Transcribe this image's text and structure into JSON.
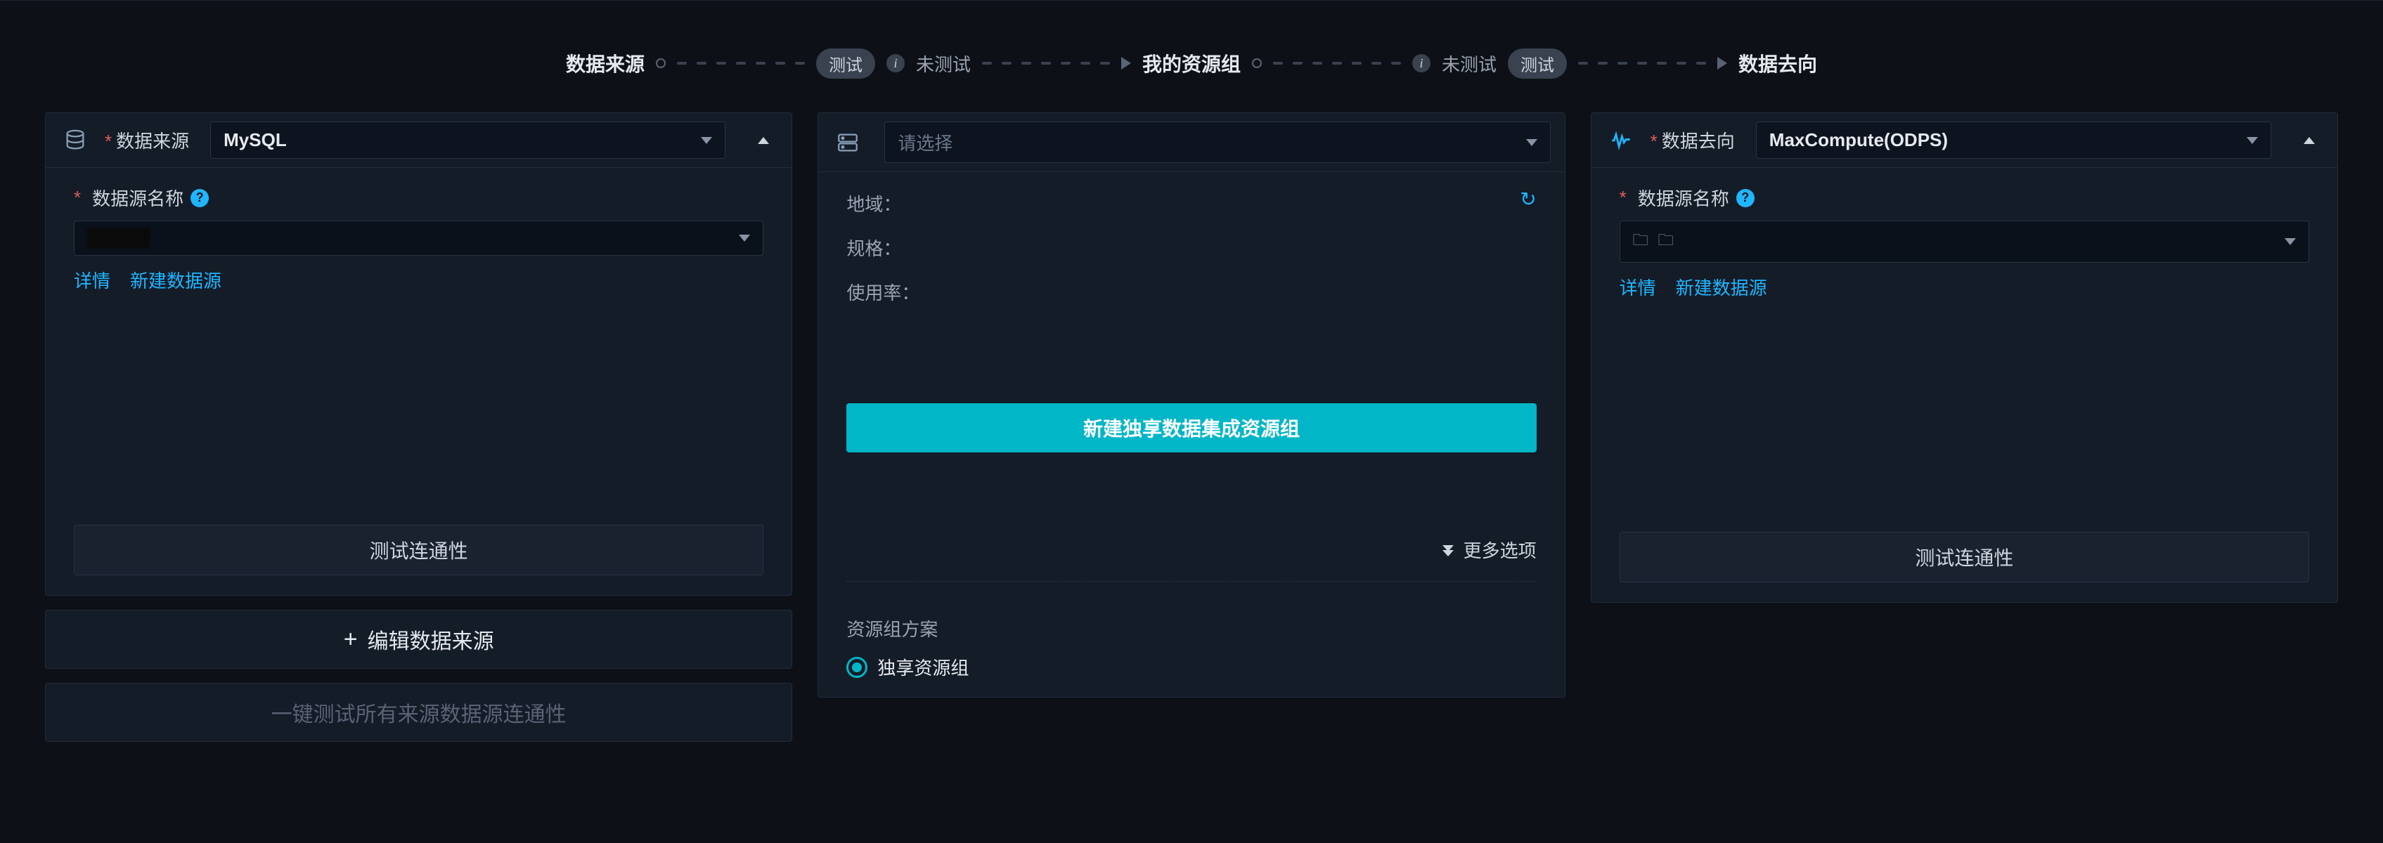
{
  "rail": {
    "source_label": "数据来源",
    "test_pill": "测试",
    "untested": "未测试",
    "resource_group_label": "我的资源组",
    "dest_label": "数据去向"
  },
  "source": {
    "header_label": "数据来源",
    "select_value": "MySQL",
    "name_label": "数据源名称",
    "detail_link": "详情",
    "new_link": "新建数据源",
    "test_btn": "测试连通性"
  },
  "source_extra": {
    "edit_btn": "编辑数据来源",
    "bulk_test_btn": "一键测试所有来源数据源连通性"
  },
  "middle": {
    "select_placeholder": "请选择",
    "region_label": "地域：",
    "spec_label": "规格：",
    "usage_label": "使用率：",
    "cta_label": "新建独享数据集成资源组",
    "more_label": "更多选项",
    "scheme_label": "资源组方案",
    "radio_exclusive": "独享资源组"
  },
  "dest": {
    "header_label": "数据去向",
    "select_value": "MaxCompute(ODPS)",
    "name_label": "数据源名称",
    "detail_link": "详情",
    "new_link": "新建数据源",
    "test_btn": "测试连通性"
  }
}
